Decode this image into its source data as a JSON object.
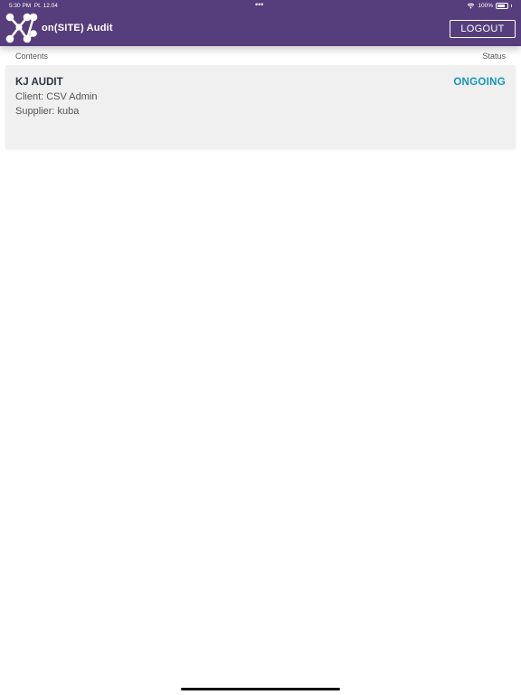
{
  "status_bar": {
    "time": "5:30 PM",
    "date": "Pt. 12.04",
    "dots": "•••",
    "battery": "100%"
  },
  "header": {
    "app_title": "on(SITE) Audit",
    "logout_label": "LOGOUT",
    "background_color": "#563d7c"
  },
  "table": {
    "contents_header": "Contents",
    "status_header": "Status"
  },
  "audits": [
    {
      "title": "KJ AUDIT",
      "client": "Client: CSV Admin",
      "supplier": "Supplier: kuba",
      "status": "ONGOING",
      "status_color": "#1896b8"
    }
  ]
}
